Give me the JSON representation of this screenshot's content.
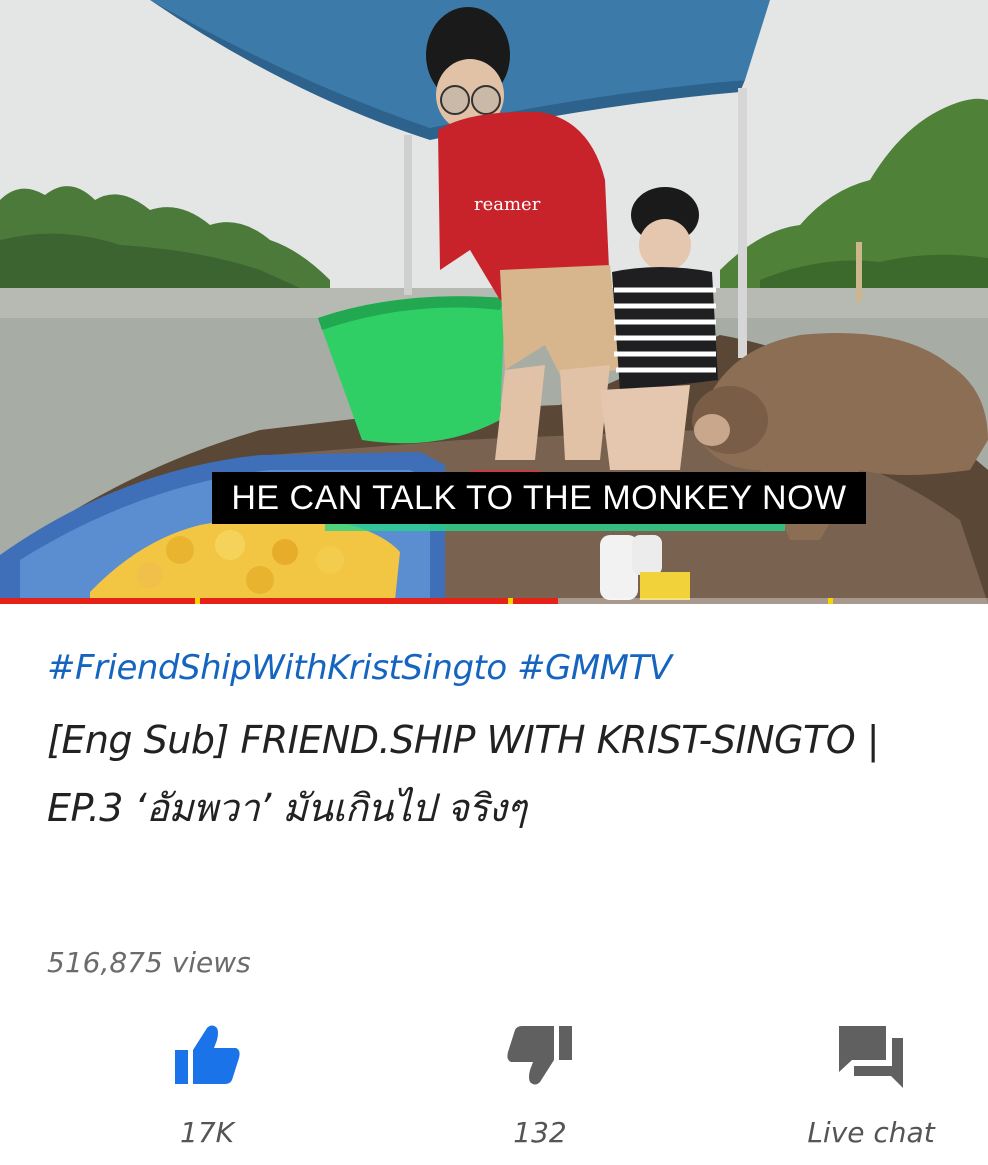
{
  "video": {
    "caption": "HE CAN TALK TO THE MONKEY NOW",
    "shirt_text": "reamer",
    "progress_fraction": 0.565,
    "colors": {
      "progress": "#e62117",
      "ad_marker": "#f7d300"
    }
  },
  "info": {
    "hashtags": "#FriendShipWithKristSingto #GMMTV",
    "title": "[Eng Sub] FRIEND.SHIP WITH KRIST-SINGTO | EP.3 ‘อัมพวา’ มันเกินไป จริงๆ",
    "views": "516,875 views"
  },
  "actions": {
    "like": {
      "icon": "thumbs-up-icon",
      "label": "17K",
      "color": "#1a73e8"
    },
    "dislike": {
      "icon": "thumbs-down-icon",
      "label": "132",
      "color": "#606060"
    },
    "chat": {
      "icon": "live-chat-icon",
      "label": "Live chat",
      "color": "#606060"
    }
  },
  "colors": {
    "hashtag": "#1565c0",
    "title": "#222222",
    "meta": "#6b6b6b"
  }
}
